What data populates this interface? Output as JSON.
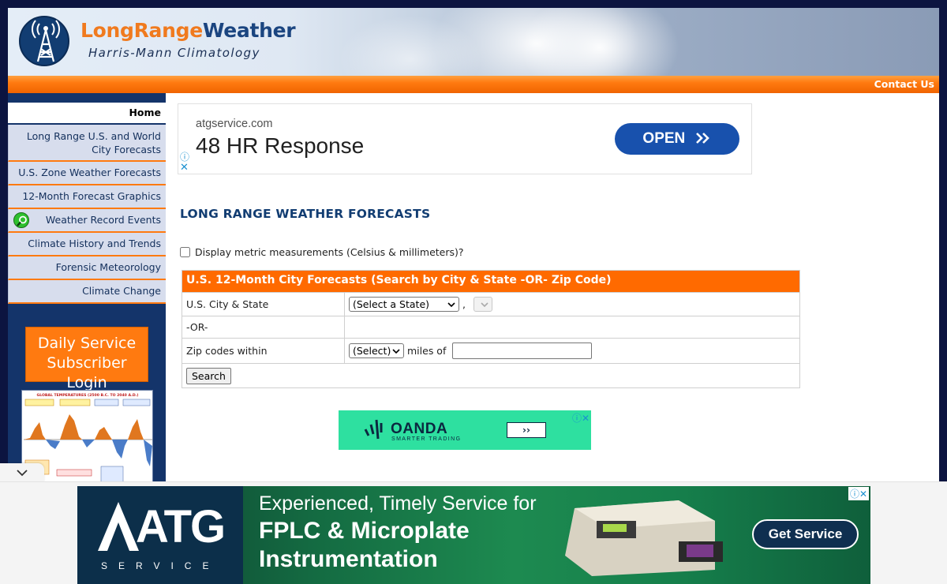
{
  "header": {
    "logo_long_range": "LongRange",
    "logo_weather": "Weather",
    "logo_subtitle": "Harris-Mann Climatology",
    "contact_label": "Contact Us"
  },
  "sidebar": {
    "items": [
      {
        "label": "Home"
      },
      {
        "label": "Long Range U.S. and World City Forecasts"
      },
      {
        "label": "U.S. Zone Weather Forecasts"
      },
      {
        "label": "12-Month Forecast Graphics"
      },
      {
        "label": "Weather Record Events"
      },
      {
        "label": "Climate History and Trends"
      },
      {
        "label": "Forensic Meteorology"
      },
      {
        "label": "Climate Change"
      }
    ],
    "login_line1": "Daily Service",
    "login_line2": "Subscriber Login",
    "graphic_title": "GLOBAL TEMPERATURES (2500 B.C. TO 2040 A.D.)"
  },
  "ad_top": {
    "domain": "atgservice.com",
    "headline": "48 HR Response",
    "button": "OPEN"
  },
  "main": {
    "title": "LONG RANGE WEATHER FORECASTS",
    "metric_label": "Display metric measurements (Celsius & millimeters)?",
    "metric_checked": false,
    "table": {
      "header": "U.S. 12-Month City Forecasts (Search by City & State -OR- Zip Code)",
      "city_state_label": "U.S. City & State",
      "state_select": "(Select a State)",
      "comma": ",",
      "city_select": "",
      "or_label": "-OR-",
      "zip_label": "Zip codes within",
      "miles_select": "(Select)",
      "miles_of": "miles of",
      "zip_value": "",
      "search_button": "Search"
    }
  },
  "ad_mid": {
    "brand": "OANDA",
    "tagline": "SMARTER TRADING",
    "arrow": "››"
  },
  "ad_bottom": {
    "logo": "ATG",
    "logo_sub": "SERVICE",
    "line1": "Experienced, Timely Service for",
    "line2": "FPLC & Microplate",
    "line3": "Instrumentation",
    "cta": "Get Service"
  },
  "icons": {
    "tower": "radio-tower-icon",
    "search": "magnifier-icon",
    "chevrons": "double-chevron-icon",
    "adchoices": "ad-info-icon",
    "close": "close-icon",
    "collapse": "chevron-down-icon"
  },
  "colors": {
    "orange": "#ff6a00",
    "navy": "#14346a",
    "ad_blue": "#1851ad",
    "oanda_green": "#2ee0a0"
  }
}
